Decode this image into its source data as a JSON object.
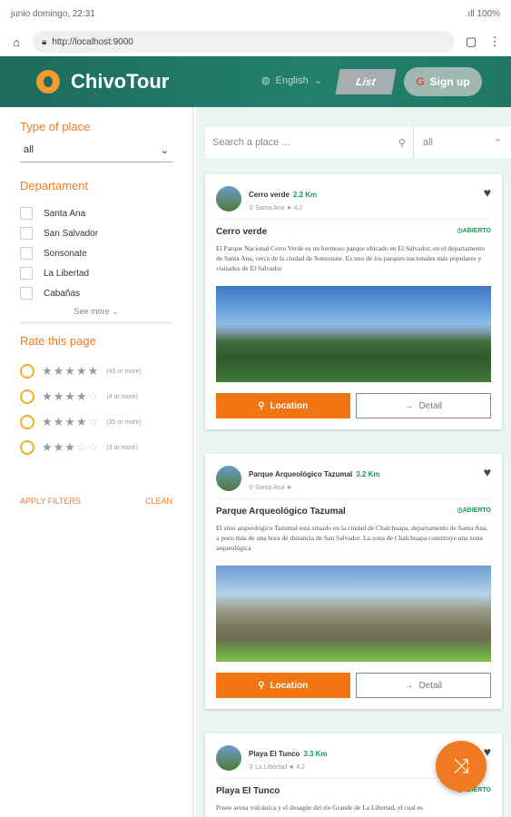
{
  "status": {
    "left": "junio domingo, 22:31",
    "right": ".ıll 100%"
  },
  "browser": {
    "url": "http://localhost:9000"
  },
  "header": {
    "brand": "ChivoTour",
    "language": "English",
    "list_label": "List",
    "signup_label": "Sign up"
  },
  "sidebar": {
    "type_title": "Type of place",
    "type_value": "all",
    "dept_title": "Departament",
    "depts": [
      "Santa Ana",
      "San Salvador",
      "Sonsonate",
      "La Libertad",
      "Cabañas"
    ],
    "see_more": "See more",
    "rate_title": "Rate this page",
    "rates": [
      "(45 or more)",
      "(4 or more)",
      "(35 or more)",
      "(3 or more)"
    ],
    "apply": "APPLY FILTERS",
    "clean": "CLEAN"
  },
  "search": {
    "placeholder": "Search a place ...",
    "filter": "all"
  },
  "cards": [
    {
      "name": "Cerro verde",
      "km": "2.2 Km",
      "place": "Santa Ana",
      "rating": "4.2",
      "title": "Cerro verde",
      "status": "ABIERTO",
      "desc": "El Parque Nacional Cerro Verde es un hermoso parque ubicado en El Salvador, en el departamento de Santa Ana, cerca de la ciudad de Sonsonate. Es uno de los parques nacionales más populares y visitados de El Salvador",
      "loc": "Location",
      "detail": "Detail"
    },
    {
      "name": "Parque Arqueológico Tazumal",
      "km": "3.2 Km",
      "place": "Santa Ana",
      "rating": "",
      "title": "Parque Arqueológico Tazumal",
      "status": "ABIERTO",
      "desc": "El sitio arqueológico Tazumal está situado en la ciudad de Chalchuapa, departamento de Santa Ana, a poco más de una hora de distancia de San Salvador. La zona de Chalchuapa constituye una zona arqueológica",
      "loc": "Location",
      "detail": "Detail"
    },
    {
      "name": "Playa El Tunco",
      "km": "3.3 Km",
      "place": "La Libertad",
      "rating": "4.2",
      "title": "Playa El Tunco",
      "status": "ABIERTO",
      "desc": "Posee arena volcánica y el desagüe del río Grande de La Libertad, el cual es"
    }
  ]
}
